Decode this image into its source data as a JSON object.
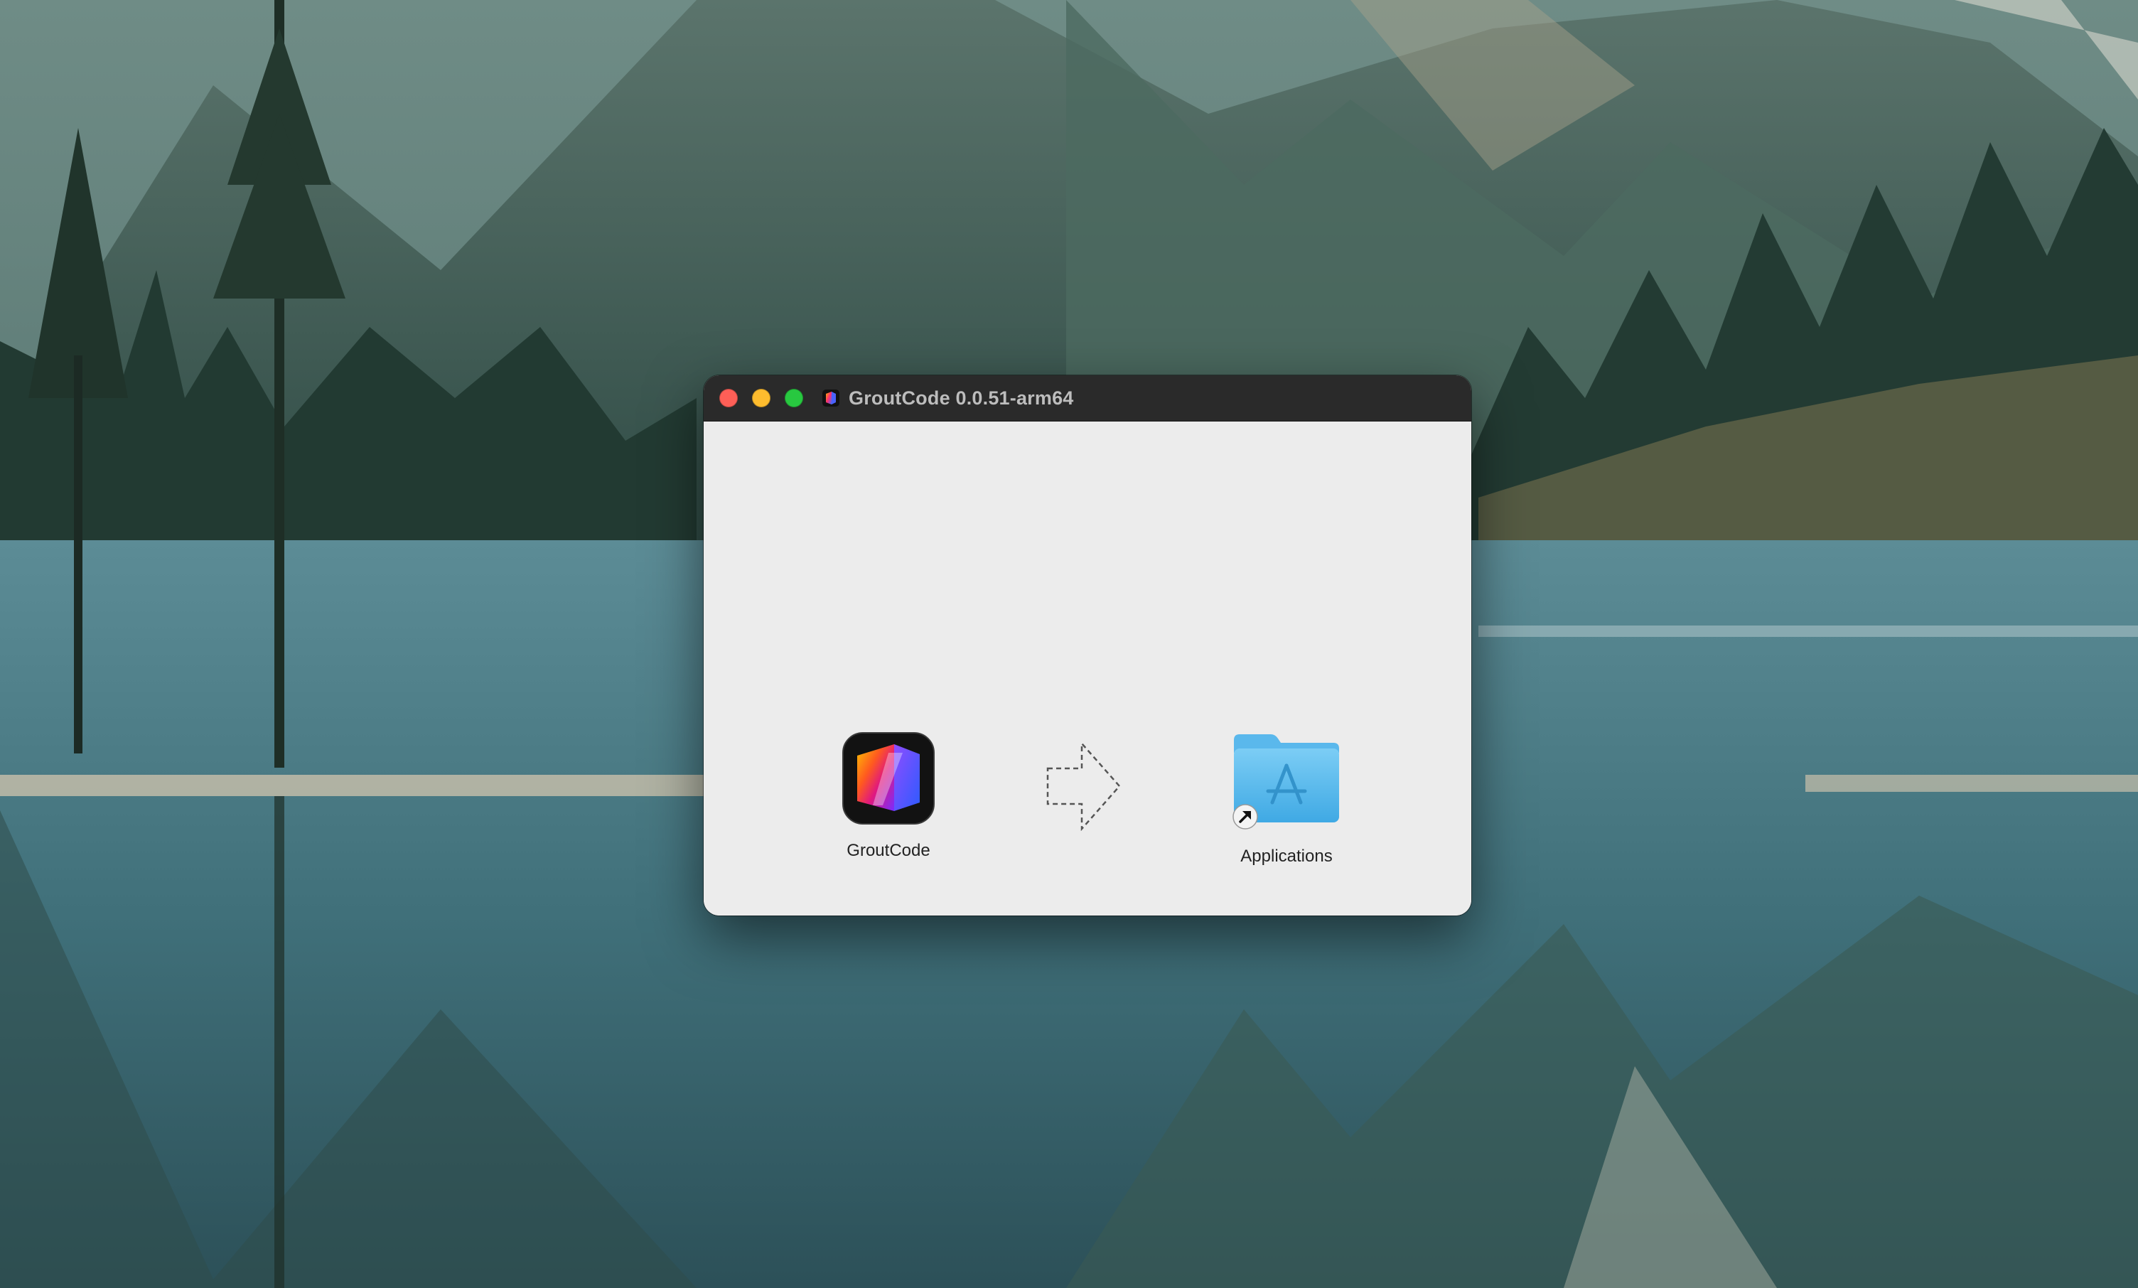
{
  "window": {
    "title": "GroutCode 0.0.51-arm64",
    "title_icon": "groutcode-app-icon"
  },
  "traffic_lights": {
    "close_color": "#fe5f57",
    "minimize_color": "#febc2e",
    "maximize_color": "#28c840"
  },
  "items": {
    "app": {
      "label": "GroutCode",
      "icon": "groutcode-app-icon"
    },
    "arrow": {
      "icon": "dashed-arrow-right-icon"
    },
    "applications": {
      "label": "Applications",
      "icon": "applications-folder-icon",
      "badge": "alias-arrow-icon"
    }
  },
  "colors": {
    "titlebar": "#2a2a2a",
    "content_bg": "#ececec",
    "folder_blue": "#5ab8ec"
  }
}
